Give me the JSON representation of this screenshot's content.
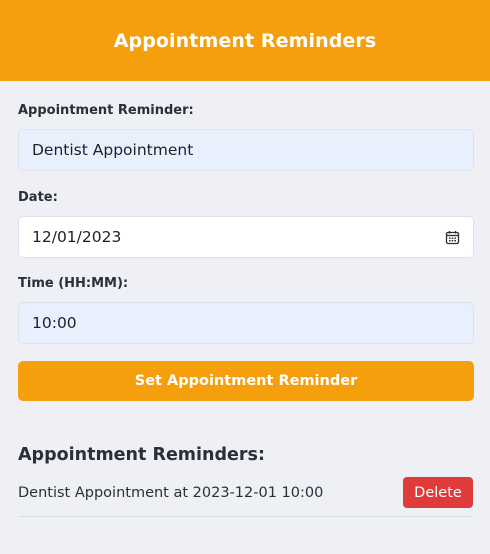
{
  "header": {
    "title": "Appointment Reminders"
  },
  "form": {
    "reminder_label": "Appointment Reminder:",
    "reminder_value": "Dentist Appointment",
    "date_label": "Date:",
    "date_value": "12/01/2023",
    "date_icon": "calendar-icon",
    "time_label": "Time (HH:MM):",
    "time_value": "10:00",
    "submit_label": "Set Appointment Reminder"
  },
  "reminders": {
    "title": "Appointment Reminders:",
    "items": [
      {
        "text": "Dentist Appointment at 2023-12-01 10:00",
        "delete_label": "Delete"
      }
    ]
  },
  "colors": {
    "accent": "#f59f0c",
    "background": "#eef0f5",
    "input_filled": "#e8f0fe",
    "delete": "#e03b3b"
  }
}
